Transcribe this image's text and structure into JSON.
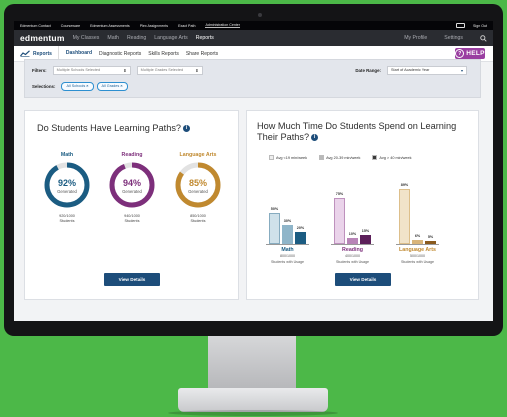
{
  "topbar": {
    "items": [
      "Edmentum Contact",
      "Courseware",
      "Edmentum Assessments",
      "Plex Assignments",
      "Exact Path",
      "Administration Center"
    ],
    "sign_out": "Sign Out"
  },
  "navbar": {
    "logo": "edmentum",
    "items": [
      "My Classes",
      "Math",
      "Reading",
      "Language Arts",
      "Reports"
    ],
    "active": "Reports",
    "right": [
      "My Profile",
      "Settings"
    ]
  },
  "subnav": {
    "section": "Reports",
    "tabs": [
      "Dashboard",
      "Diagnostic Reports",
      "Skills Reports",
      "Share Reports"
    ],
    "active": "Dashboard",
    "help_label": "HELP"
  },
  "filters": {
    "label": "Filters:",
    "schools_value": "Multiple Schools Selected",
    "grades_value": "Multiple Grades Selected",
    "date_range_label": "Date Range:",
    "date_range_value": "Start of Academic Year",
    "selections_label": "Selections:",
    "chips": [
      "All Schools",
      "All Grades"
    ]
  },
  "learning_paths": {
    "title": "Do Students Have Learning Paths?",
    "subjects": [
      {
        "name": "Math",
        "percent": "92%",
        "sub": "Generated",
        "count": "920/1000",
        "unit": "Students",
        "color": "#1b5c82",
        "fraction": 0.92
      },
      {
        "name": "Reading",
        "percent": "94%",
        "sub": "Generated",
        "count": "940/1000",
        "unit": "Students",
        "color": "#7d2f7b",
        "fraction": 0.94
      },
      {
        "name": "Language Arts",
        "percent": "85%",
        "sub": "Generated",
        "count": "850/1000",
        "unit": "Students",
        "color": "#c0892f",
        "fraction": 0.85
      }
    ],
    "button": "View Details"
  },
  "time_spent": {
    "title": "How Much Time Do Students Spend on Learning Their Paths?",
    "legend": [
      "Avg <19 min/week",
      "Avg 20-39 min/week",
      "Avg > 40 min/week"
    ],
    "legend_colors": [
      "#eeeeee",
      "#b9b9b9",
      "#3a3a3a"
    ],
    "groups": [
      {
        "name": "Math",
        "count": "800/1000",
        "caption": "Students with Usage",
        "color": "#1b5c82",
        "values": [
          50,
          30,
          20
        ],
        "labels": [
          "50%",
          "30%",
          "20%"
        ],
        "shades": [
          "#cfe1ea",
          "#8fb5c9",
          "#1b5c82"
        ]
      },
      {
        "name": "Reading",
        "count": "400/1000",
        "caption": "Students with Usage",
        "color": "#7d2f7b",
        "values": [
          75,
          10,
          15
        ],
        "labels": [
          "75%",
          "10%",
          "15%"
        ],
        "shades": [
          "#ead3ea",
          "#b884b7",
          "#5c1f5a"
        ]
      },
      {
        "name": "Language Arts",
        "count": "500/1000",
        "caption": "Students with Usage",
        "color": "#c0892f",
        "values": [
          89,
          6,
          5
        ],
        "labels": [
          "89%",
          "6%",
          "5%"
        ],
        "shades": [
          "#f1e3c9",
          "#d9b57a",
          "#8a5a1d"
        ]
      }
    ],
    "button": "View Details"
  }
}
